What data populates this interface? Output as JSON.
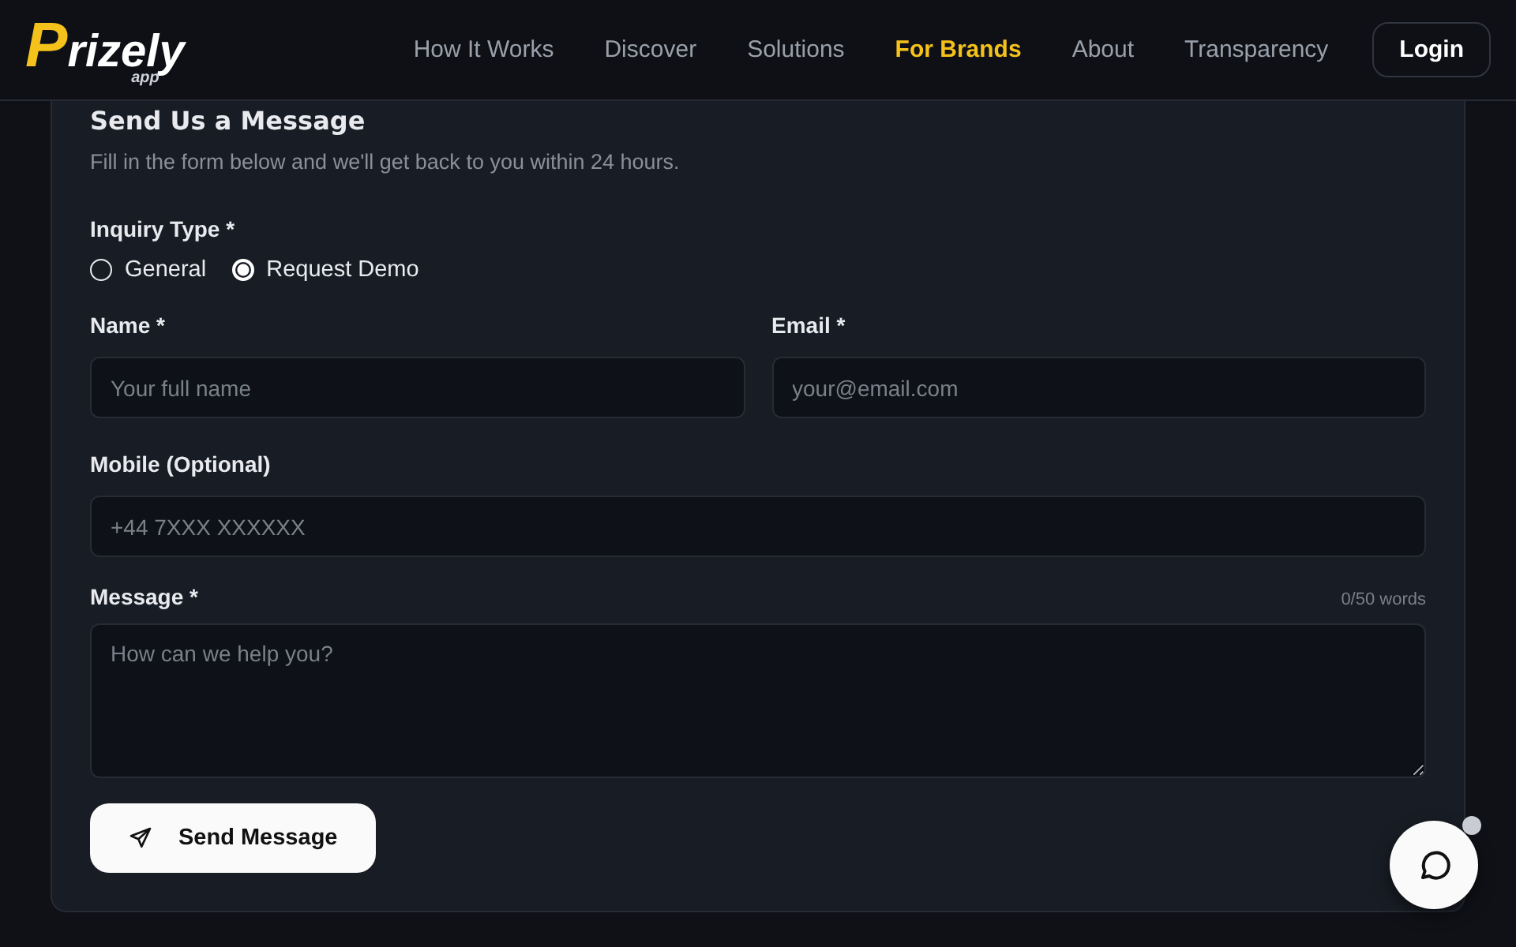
{
  "header": {
    "logo": {
      "mark": "P",
      "text": "rizely",
      "sub": "app"
    },
    "nav": [
      {
        "label": "How It Works",
        "selected": false
      },
      {
        "label": "Discover",
        "selected": false
      },
      {
        "label": "Solutions",
        "selected": false
      },
      {
        "label": "For Brands",
        "selected": true
      },
      {
        "label": "About",
        "selected": false
      },
      {
        "label": "Transparency",
        "selected": false
      }
    ],
    "login": "Login"
  },
  "form": {
    "title": "Send Us a Message",
    "subtitle": "Fill in the form below and we'll get back to you within 24 hours.",
    "inquiry": {
      "label": "Inquiry Type *",
      "options": [
        {
          "label": "General",
          "selected": false
        },
        {
          "label": "Request Demo",
          "selected": true
        }
      ]
    },
    "name": {
      "label": "Name *",
      "placeholder": "Your full name"
    },
    "email": {
      "label": "Email *",
      "placeholder": "your@email.com"
    },
    "mobile": {
      "label": "Mobile (Optional)",
      "placeholder": "+44 7XXX XXXXXX"
    },
    "message": {
      "label": "Message *",
      "counter": "0/50 words",
      "placeholder": "How can we help you?"
    },
    "submit": "Send Message"
  }
}
